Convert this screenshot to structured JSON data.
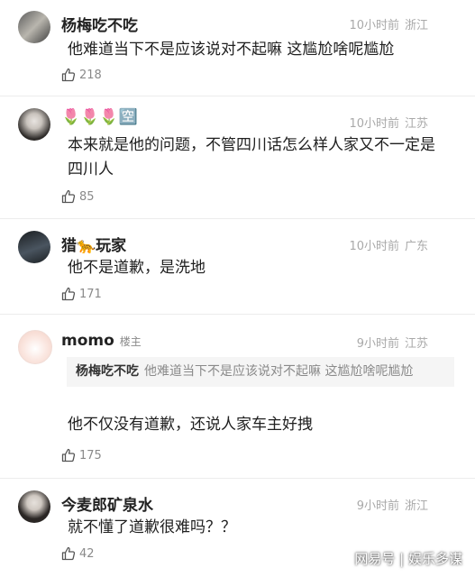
{
  "comments": [
    {
      "username": "杨梅吃不吃",
      "time": "10小时前",
      "location": "浙江",
      "text": "他难道当下不是应该说对不起嘛 这尴尬啥呢尴尬",
      "likes": "218"
    },
    {
      "username": "🌷🌷🌷🈳",
      "time": "10小时前",
      "location": "江苏",
      "text": "本来就是他的问题，不管四川话怎么样人家又不一定是四川人",
      "likes": "85"
    },
    {
      "username": "猎🐆玩家",
      "time": "10小时前",
      "location": "广东",
      "text": "他不是道歉，是洗地",
      "likes": "171"
    },
    {
      "username": "momo",
      "owner_badge": "楼主",
      "time": "9小时前",
      "location": "江苏",
      "quote_name": "杨梅吃不吃",
      "quote_text": "他难道当下不是应该说对不起嘛 这尴尬啥呢尴尬",
      "text": "他不仅没有道歉，还说人家车主好拽",
      "likes": "175"
    },
    {
      "username": "今麦郎矿泉水",
      "time": "9小时前",
      "location": "浙江",
      "text": "就不懂了道歉很难吗？？",
      "likes": "42"
    }
  ],
  "watermark": "网易号 | 娱乐多谋",
  "icons": {
    "like": "thumbs-up-icon"
  }
}
